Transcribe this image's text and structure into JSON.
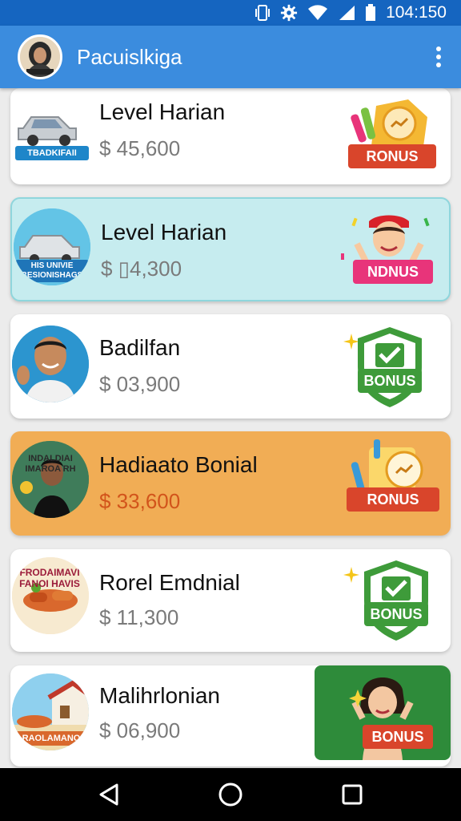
{
  "status_bar": {
    "time": "104:150"
  },
  "app_bar": {
    "title": "Pacuislkiga"
  },
  "cards": [
    {
      "title": "Level Harian",
      "amount": "$ 45,600",
      "thumb_label": "TBADKIFAII",
      "badge_label": "RONUS"
    },
    {
      "title": "Level Harian",
      "amount": "$ ▯4,300",
      "thumb_label": "HIS UNIVIE BESIONISHAGS",
      "badge_label": "NDNUS"
    },
    {
      "title": "Badilfan",
      "amount": "$ 03,900",
      "badge_label": "BONUS"
    },
    {
      "title": "Hadiaato Bonial",
      "amount": "$ 33,600",
      "thumb_label": "INDALDIAI IMAROA RH",
      "badge_label": "RONUS"
    },
    {
      "title": "Rorel Emdnial",
      "amount": "$ 11,300",
      "thumb_label": "FRODAIMAVI FANOI HAVIS",
      "badge_label": "BONUS"
    },
    {
      "title": "Malihrlonian",
      "amount": "$ 06,900",
      "thumb_label": "RAOLAMANO",
      "badge_label": "BONUS"
    }
  ],
  "colors": {
    "status_bar": "#1565c0",
    "app_bar": "#3b8cde",
    "card_cyan": "#c6ecef",
    "card_orange": "#f1ad55",
    "bonus_green": "#3e9b3a",
    "ribbon_red": "#d9452b"
  }
}
